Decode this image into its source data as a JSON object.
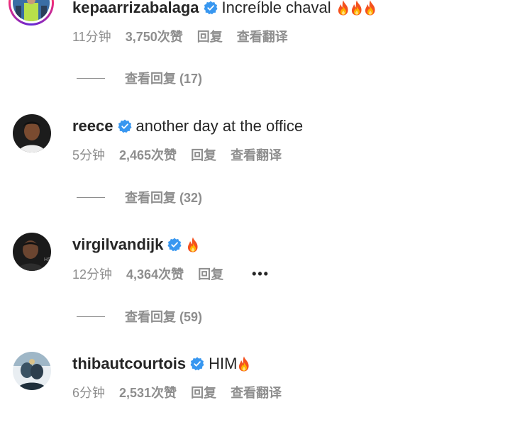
{
  "comments": [
    {
      "username": "kepaarrizabalaga",
      "text": "Increíble chaval",
      "emoji": [
        "fire",
        "fire",
        "fire"
      ],
      "time": "11分钟",
      "likes": "3,750次赞",
      "reply": "回复",
      "translate": "查看翻译",
      "view_replies": "查看回复 (17)",
      "avatar_story_ring": true
    },
    {
      "username": "reece",
      "text": "another day at the office",
      "emoji": [],
      "time": "5分钟",
      "likes": "2,465次赞",
      "reply": "回复",
      "translate": "查看翻译",
      "view_replies": "查看回复 (32)",
      "avatar_story_ring": false
    },
    {
      "username": "virgilvandijk",
      "text": "",
      "emoji": [
        "fire"
      ],
      "time": "12分钟",
      "likes": "4,364次赞",
      "reply": "回复",
      "more": "•••",
      "view_replies": "查看回复 (59)",
      "avatar_story_ring": false
    },
    {
      "username": "thibautcourtois",
      "text": "HIM",
      "emoji": [
        "fire"
      ],
      "time": "6分钟",
      "likes": "2,531次赞",
      "reply": "回复",
      "translate": "查看翻译",
      "avatar_story_ring": false
    }
  ],
  "colors": {
    "verified": "#3897f0",
    "meta_text": "#8e8e8e",
    "primary_text": "#262626"
  }
}
